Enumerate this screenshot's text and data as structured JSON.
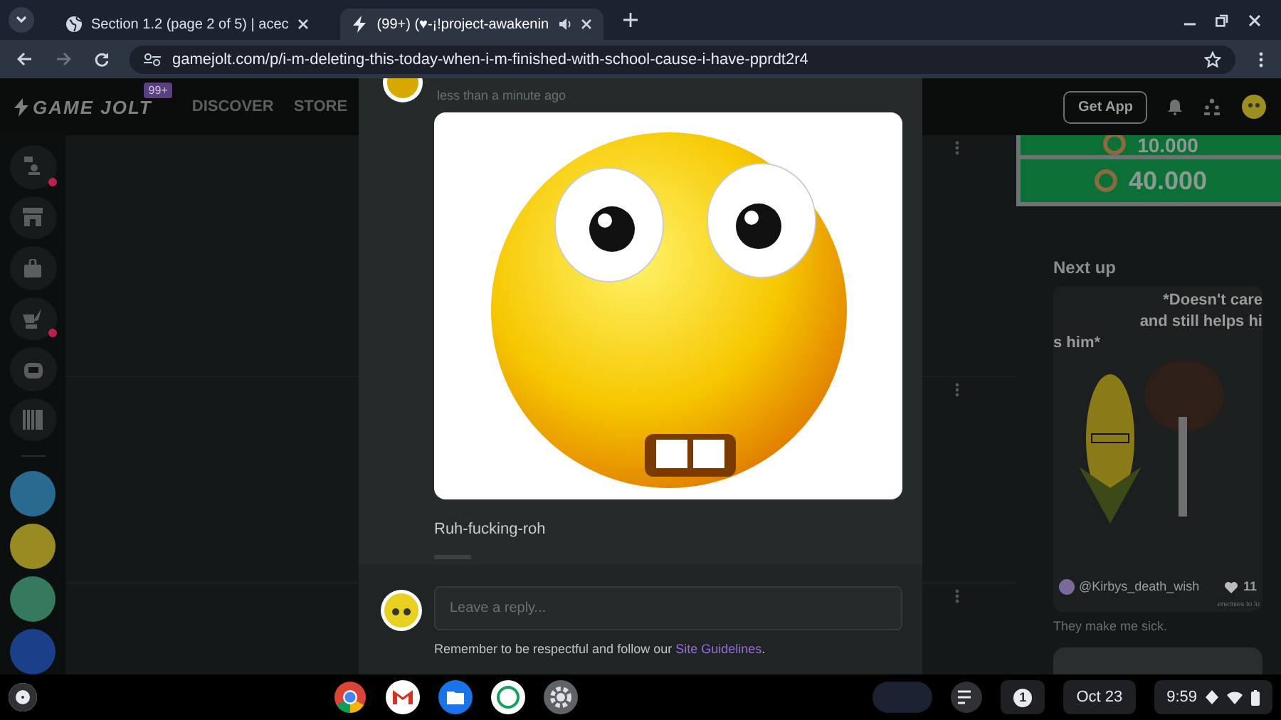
{
  "browser": {
    "tabs": [
      {
        "title": "Section 1.2 (page 2 of 5) | acec",
        "selected": false,
        "kind": "globe"
      },
      {
        "title": "(99+) (♥-¡!project-awakenin",
        "selected": true,
        "kind": "bolt"
      }
    ],
    "url": "gamejolt.com/p/i-m-deleting-this-today-when-i-m-finished-with-school-cause-i-have-pprdt2r4"
  },
  "site_header": {
    "logo": "GAME JOLT",
    "badge": "99+",
    "nav": [
      "DISCOVER",
      "STORE"
    ],
    "get_app": "Get App"
  },
  "sidebar": {
    "items": [
      {
        "kind": "chat",
        "alert": true
      },
      {
        "kind": "store",
        "alert": false
      },
      {
        "kind": "bag",
        "alert": false
      },
      {
        "kind": "quill",
        "alert": true
      },
      {
        "kind": "bot",
        "alert": false
      },
      {
        "kind": "library",
        "alert": false
      }
    ],
    "communities": [
      {
        "color": "#2a6a90"
      },
      {
        "color": "#9a8a22"
      },
      {
        "color": "#357a5c"
      },
      {
        "color": "#1c3f8a"
      }
    ]
  },
  "post": {
    "timestamp": "less than a minute ago",
    "caption": "Ruh-fucking-roh",
    "reply": {
      "placeholder": "Leave a reply...",
      "note_before": "Remember to be respectful and follow our",
      "link": "Site Guidelines",
      "note_after": "."
    }
  },
  "right_panel": {
    "prices": [
      "10.000",
      "40.000"
    ],
    "next_up": "Next up",
    "video": {
      "caption_lines": [
        "*Doesn't care",
        "and still helps hi",
        "s him*"
      ],
      "author": "@Kirbys_death_wish",
      "likes": "11",
      "tag": "enemies to lo"
    },
    "description": "They make me sick."
  },
  "taskbar": {
    "notifications": "1",
    "date": "Oct 23",
    "time": "9:59"
  }
}
